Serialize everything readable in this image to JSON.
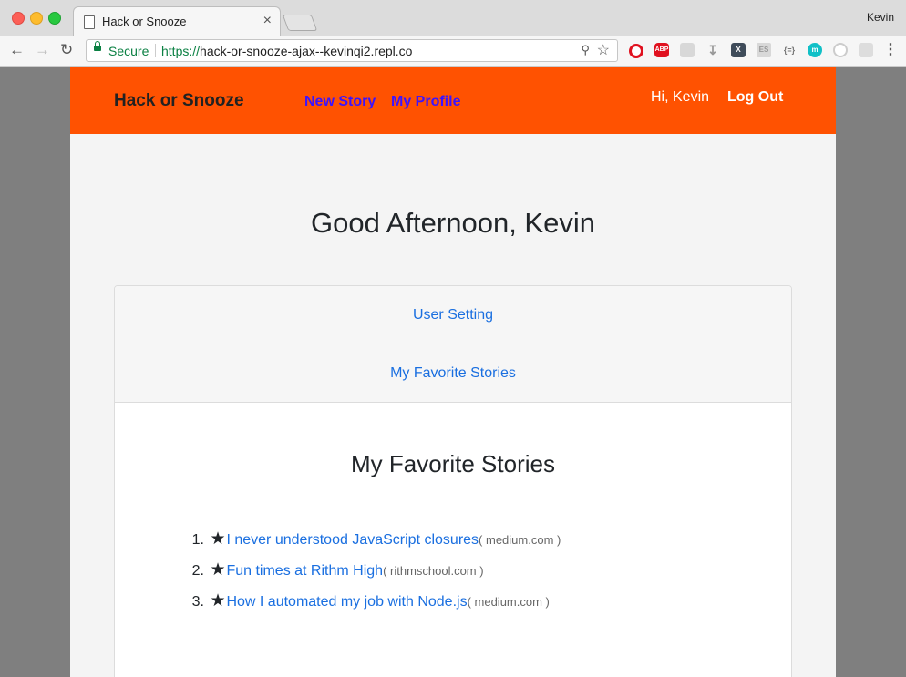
{
  "browser": {
    "tab_title": "Hack or Snooze",
    "tab_close": "×",
    "profile_name": "Kevin",
    "secure_label": "Secure",
    "url_scheme": "https://",
    "url_rest": "hack-or-snooze-ajax--kevinqi2.repl.co",
    "extensions": [
      "opera-icon",
      "adblock-plus-icon",
      "cube-icon",
      "download-icon",
      "x-extension-icon",
      "es-extension-icon",
      "json-icon",
      "m-extension-icon",
      "circle-icon",
      "settings-extension-icon"
    ]
  },
  "navbar": {
    "brand": "Hack or Snooze",
    "new_story": "New Story",
    "my_profile": "My Profile",
    "greeting": "Hi, Kevin",
    "logout": "Log Out"
  },
  "main": {
    "title": "Good Afternoon, Kevin",
    "accordion": [
      {
        "label": "User Setting"
      },
      {
        "label": "My Favorite Stories"
      }
    ],
    "favorites_title": "My Favorite Stories",
    "stories": [
      {
        "num": "1.",
        "title": "I never understood JavaScript closures",
        "host": "( medium.com )"
      },
      {
        "num": "2.",
        "title": "Fun times at Rithm High",
        "host": "( rithmschool.com )"
      },
      {
        "num": "3.",
        "title": "How I automated my job with Node.js",
        "host": "( medium.com )"
      }
    ]
  },
  "colors": {
    "navbar": "#ff5201",
    "nav_link": "#3b14ff",
    "link": "#1a6fe0"
  }
}
